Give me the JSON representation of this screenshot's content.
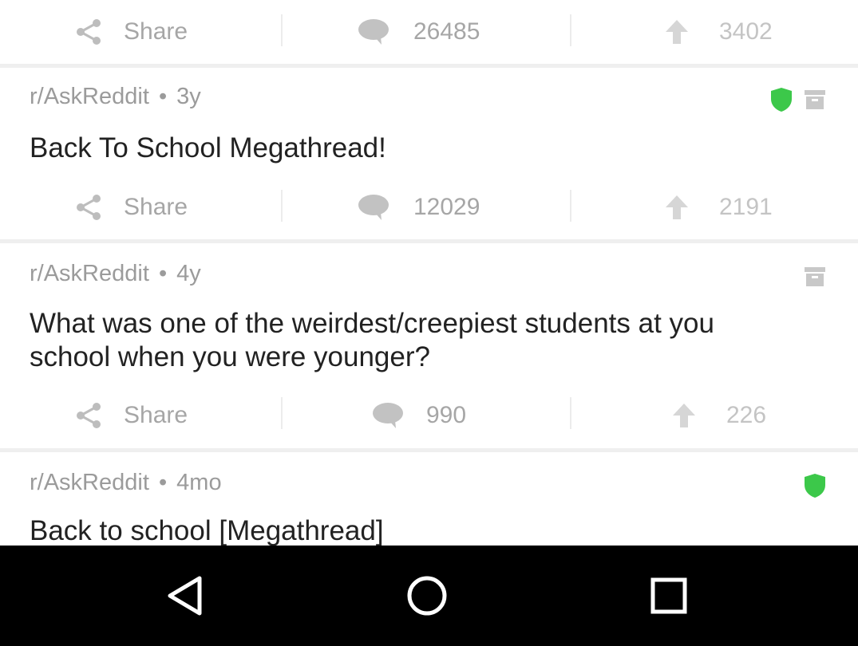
{
  "top_actions": {
    "share_label": "Share",
    "comments": "26485",
    "upvotes": "3402"
  },
  "posts": [
    {
      "subreddit": "r/AskReddit",
      "age": "3y",
      "title": "Back To School Megathread!",
      "shield": true,
      "archived": true,
      "share_label": "Share",
      "comments": "12029",
      "upvotes": "2191"
    },
    {
      "subreddit": "r/AskReddit",
      "age": "4y",
      "title": "What was one of the weirdest/creepiest students at you school when you were younger?",
      "shield": false,
      "archived": true,
      "share_label": "Share",
      "comments": "990",
      "upvotes": "226"
    },
    {
      "subreddit": "r/AskReddit",
      "age": "4mo",
      "title": "Back to school [Megathread]",
      "shield": true,
      "archived": false
    }
  ],
  "meta_separator": "•",
  "colors": {
    "shield": "#3cc84a",
    "archive": "#c8c8c8",
    "text_muted": "#9b9b9b",
    "title": "#222222",
    "navbar": "#000000"
  },
  "icons": [
    "share-icon",
    "comment-icon",
    "upvote-icon",
    "shield-icon",
    "archive-icon",
    "back-icon",
    "home-icon",
    "recents-icon"
  ]
}
